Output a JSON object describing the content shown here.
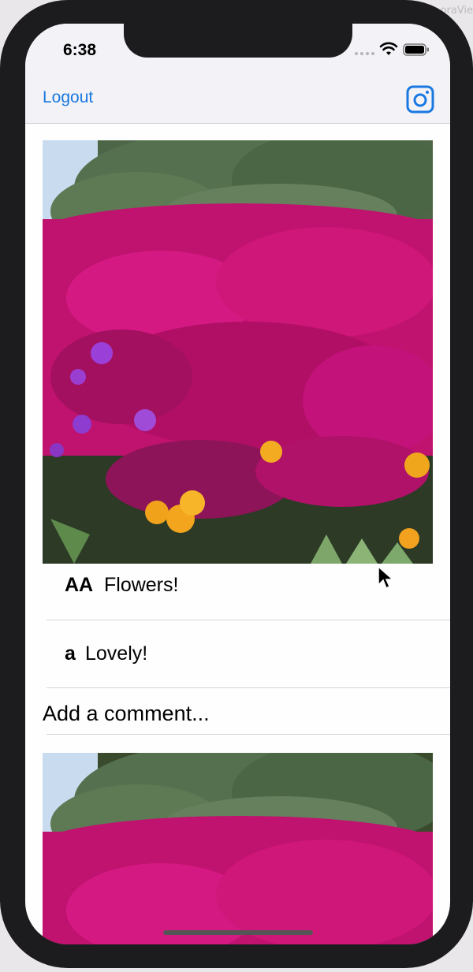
{
  "background_window_title": "oraVie",
  "status_bar": {
    "time": "6:38"
  },
  "nav": {
    "logout_label": "Logout",
    "camera_icon": "camera-icon"
  },
  "posts": [
    {
      "image_desc": "flowers",
      "caption": {
        "user": "AA",
        "text": "Flowers!"
      },
      "comments": [
        {
          "user": "a",
          "text": "Lovely!"
        }
      ],
      "add_comment_placeholder": "Add a comment..."
    },
    {
      "image_desc": "flowers"
    }
  ],
  "colors": {
    "accent": "#1a78e0",
    "nav_bg": "#f3f2f7",
    "bezel": "#1c1b1d"
  }
}
